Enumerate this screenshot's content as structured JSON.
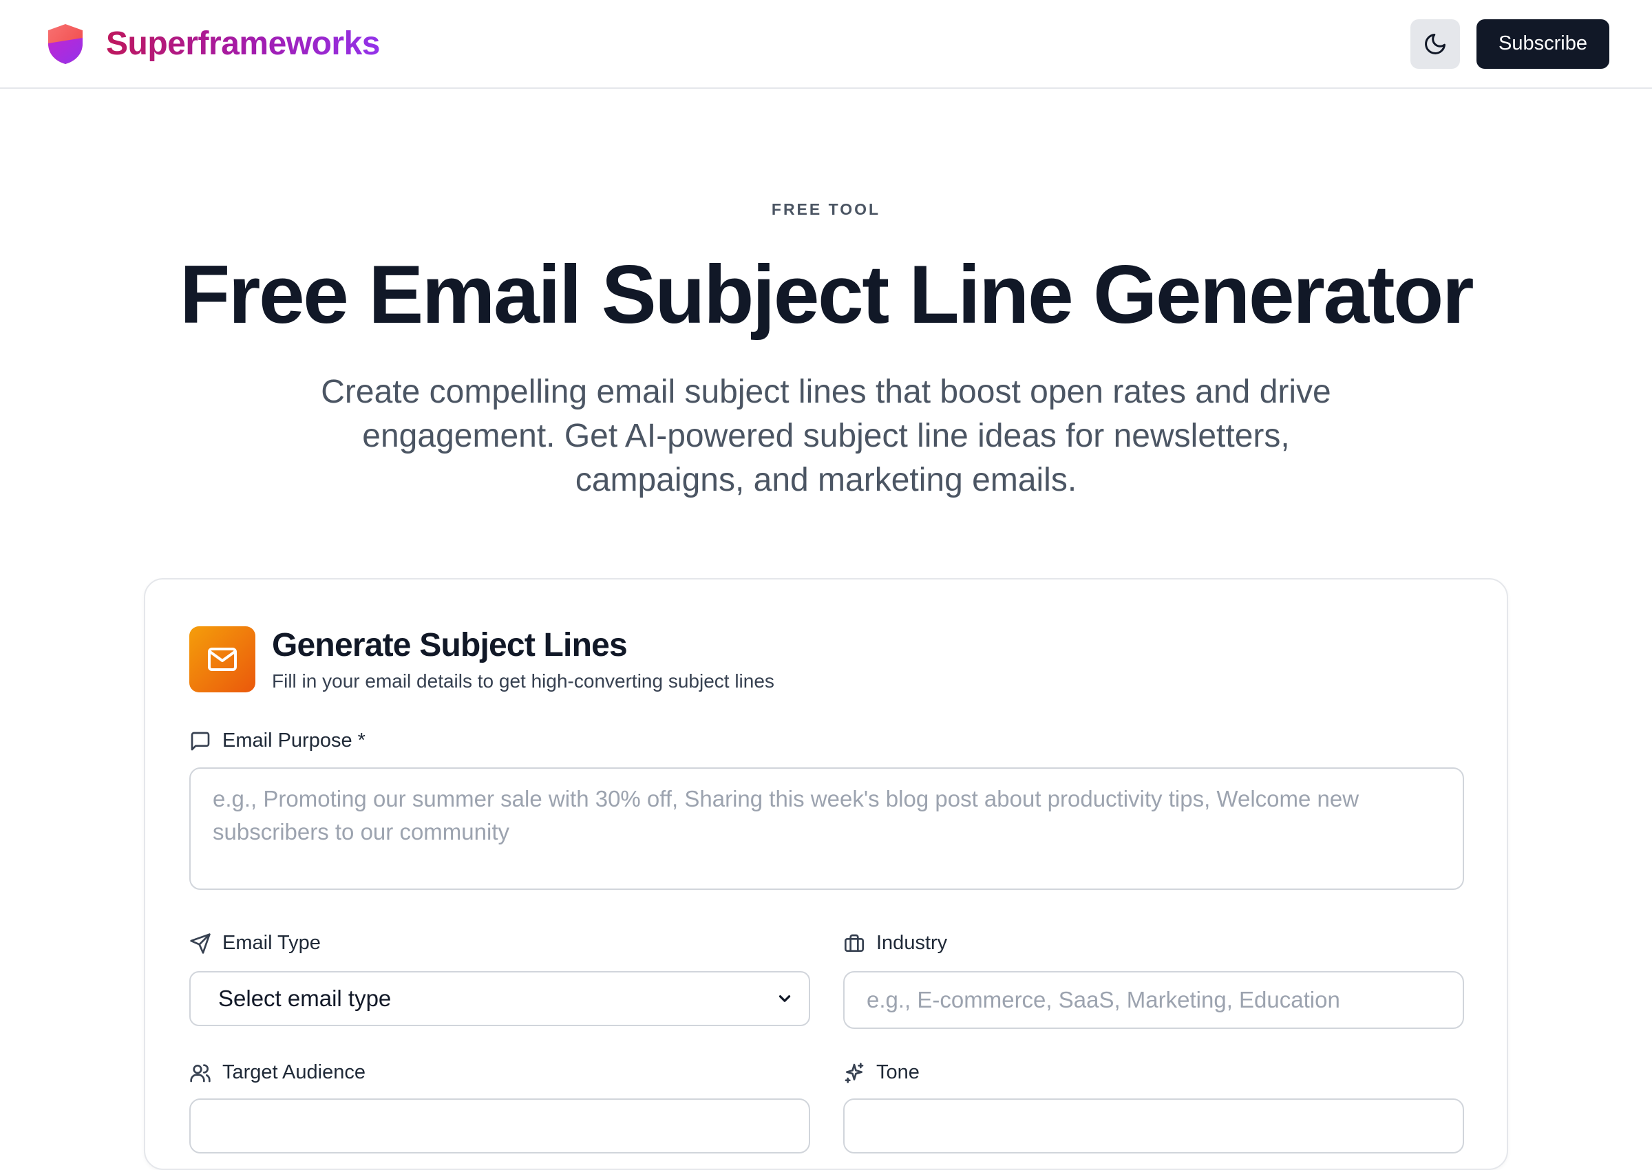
{
  "header": {
    "brand": "Superframeworks",
    "subscribe_label": "Subscribe",
    "icons": {
      "logo": "shield-logo-icon",
      "theme": "moon-icon"
    }
  },
  "hero": {
    "eyebrow": "FREE TOOL",
    "title": "Free Email Subject Line Generator",
    "subtitle": "Create compelling email subject lines that boost open rates and drive engagement. Get AI-powered subject line ideas for newsletters, campaigns, and marketing emails."
  },
  "card": {
    "title": "Generate Subject Lines",
    "description": "Fill in your email details to get high-converting subject lines",
    "icon": "mail-icon",
    "fields": {
      "purpose": {
        "label": "Email Purpose *",
        "icon": "message-square-icon",
        "value": "",
        "placeholder": "e.g., Promoting our summer sale with 30% off, Sharing this week's blog post about productivity tips, Welcome new subscribers to our community"
      },
      "type": {
        "label": "Email Type",
        "icon": "send-icon",
        "selected": "Select email type"
      },
      "industry": {
        "label": "Industry",
        "icon": "briefcase-icon",
        "value": "",
        "placeholder": "e.g., E-commerce, SaaS, Marketing, Education"
      },
      "audience": {
        "label": "Target Audience",
        "icon": "users-icon"
      },
      "tone": {
        "label": "Tone",
        "icon": "sparkles-icon"
      }
    }
  },
  "colors": {
    "primary_dark": "#111827",
    "brand_gradient_start": "#be185d",
    "brand_gradient_end": "#9333ea",
    "card_icon_start": "#f59e0b",
    "card_icon_end": "#ea580c",
    "border": "#d1d5db",
    "muted_text": "#4b5563",
    "placeholder": "#9ca3af"
  }
}
